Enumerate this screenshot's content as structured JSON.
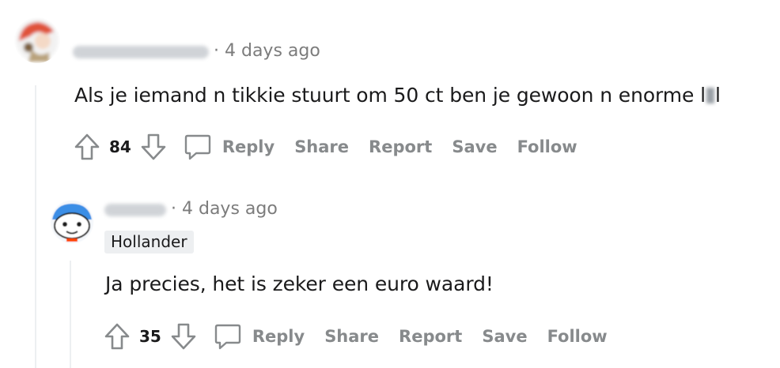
{
  "comments": [
    {
      "timestamp": "· 4 days ago",
      "body_before": "Als je iemand n tikkie stuurt om 50 ct ben je gewoon n enorme l",
      "body_after": "l",
      "score": "84",
      "actions": {
        "reply": "Reply",
        "share": "Share",
        "report": "Report",
        "save": "Save",
        "follow": "Follow"
      }
    },
    {
      "timestamp": "· 4 days ago",
      "flair": "Hollander",
      "body": "Ja precies, het is zeker een euro waard!",
      "score": "35",
      "actions": {
        "reply": "Reply",
        "share": "Share",
        "report": "Report",
        "save": "Save",
        "follow": "Follow"
      }
    }
  ],
  "icons": {
    "upvote": "upvote-arrow-icon",
    "downvote": "downvote-arrow-icon",
    "comment": "comment-bubble-icon"
  },
  "colors": {
    "action_gray": "#878a8c",
    "meta_gray": "#7c7c7c",
    "flair_bg": "#edeff1",
    "thread_line": "#edeff1"
  }
}
